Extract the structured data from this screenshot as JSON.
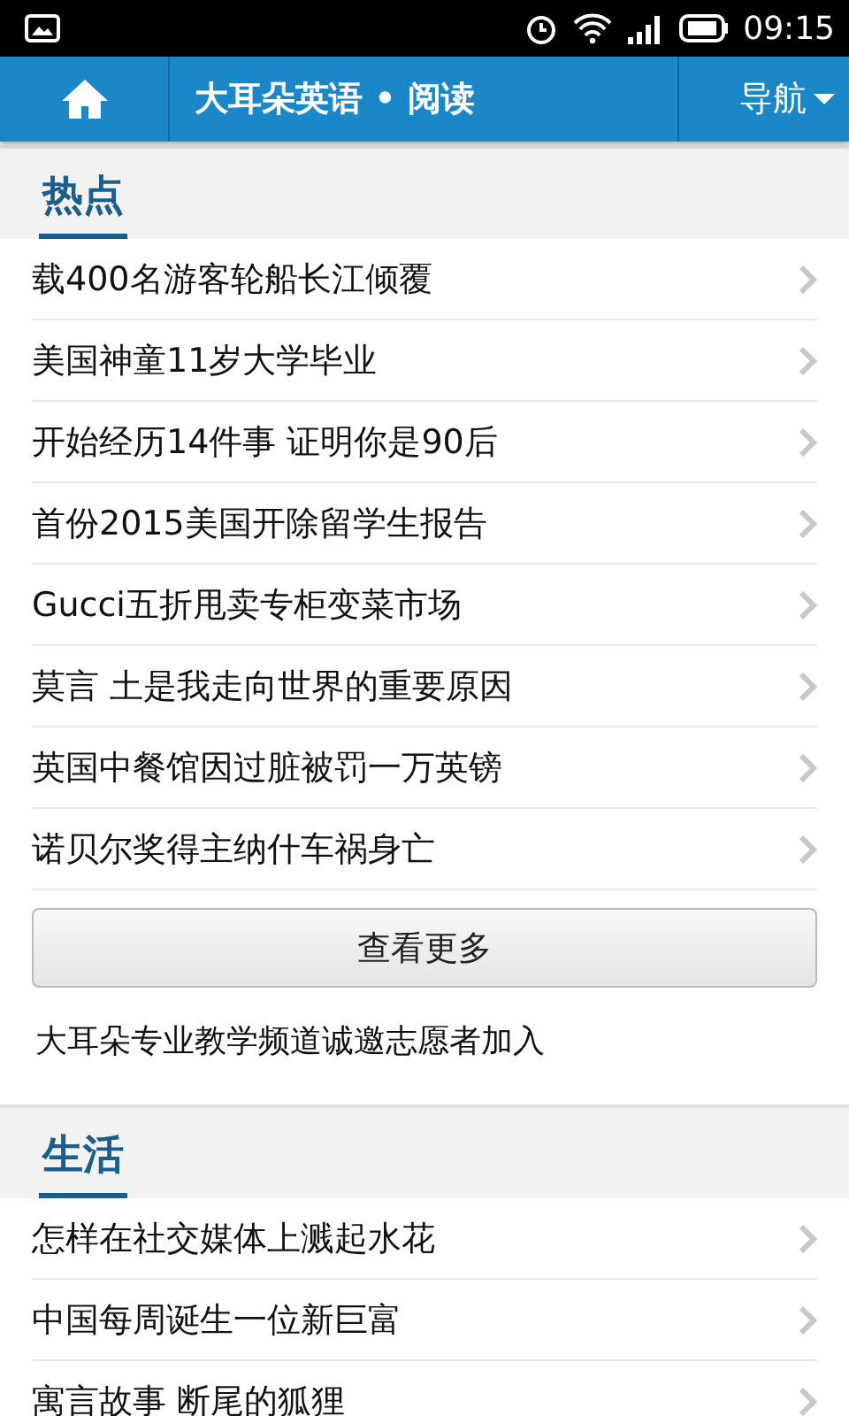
{
  "status_bar": {
    "time": "09:15"
  },
  "header": {
    "title": "大耳朵英语 • 阅读",
    "nav": "导航"
  },
  "sections": [
    {
      "title": "热点",
      "items": [
        "载400名游客轮船长江倾覆",
        "美国神童11岁大学毕业",
        "开始经历14件事 证明你是90后",
        "首份2015美国开除留学生报告",
        "Gucci五折甩卖专柜变菜市场",
        "莫言 土是我走向世界的重要原因",
        "英国中餐馆因过脏被罚一万英镑",
        "诺贝尔奖得主纳什车祸身亡"
      ],
      "more_button": "查看更多",
      "notice": "大耳朵专业教学频道诚邀志愿者加入"
    },
    {
      "title": "生活",
      "items": [
        "怎样在社交媒体上溅起水花",
        "中国每周诞生一位新巨富",
        "寓言故事 断尾的狐狸"
      ]
    }
  ]
}
